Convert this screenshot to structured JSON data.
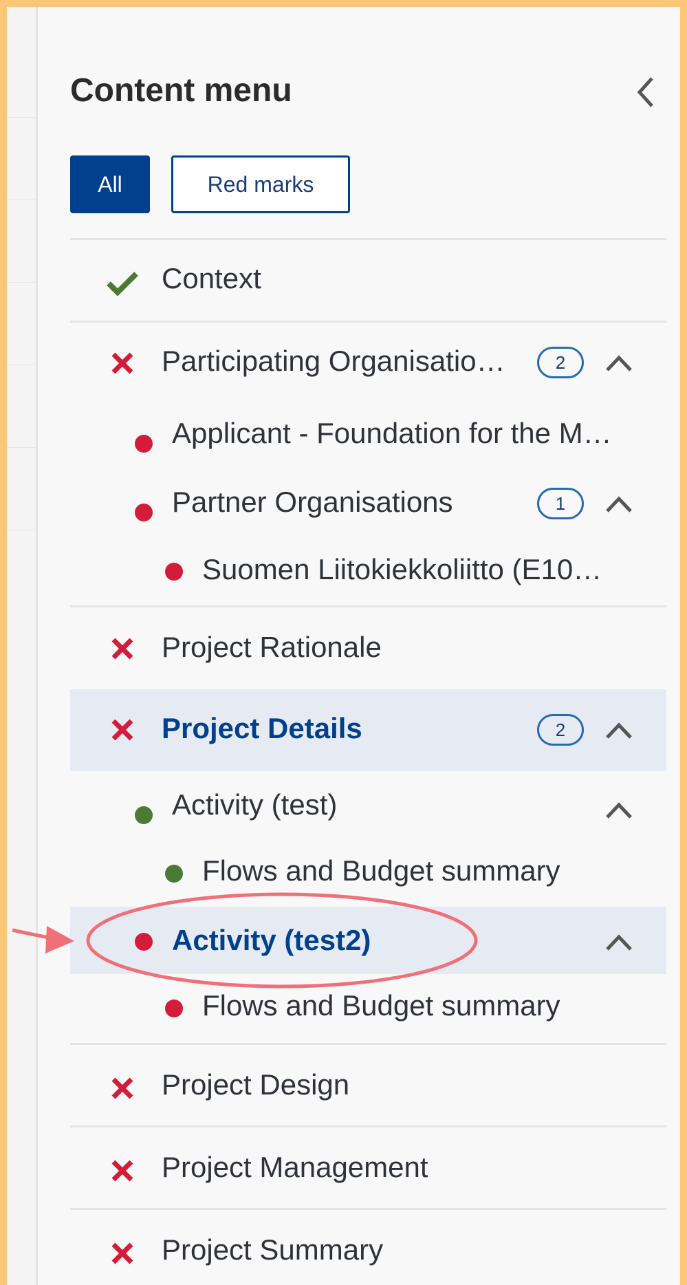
{
  "menu": {
    "title": "Content menu",
    "filters": {
      "all": "All",
      "red_marks": "Red marks"
    },
    "items": [
      {
        "label": "Context",
        "status": "check"
      },
      {
        "label": "Participating Organisatio…",
        "status": "x",
        "badge": "2",
        "expanded": true
      },
      {
        "label": "Applicant - Foundation for the M…",
        "status": "red-dot"
      },
      {
        "label": "Partner Organisations",
        "status": "red-dot",
        "badge": "1",
        "expanded": true
      },
      {
        "label": "Suomen Liitokiekkoliitto (E10…",
        "status": "red-dot"
      },
      {
        "label": "Project Rationale",
        "status": "x"
      },
      {
        "label": "Project Details",
        "status": "x",
        "badge": "2",
        "expanded": true,
        "active": true
      },
      {
        "label": "Activity (test)",
        "status": "green-dot",
        "expanded": true
      },
      {
        "label": "Flows and Budget summary",
        "status": "green-dot"
      },
      {
        "label": "Activity (test2)",
        "status": "red-dot",
        "expanded": true,
        "active": true,
        "highlighted": true
      },
      {
        "label": "Flows and Budget summary",
        "status": "red-dot"
      },
      {
        "label": "Project Design",
        "status": "x"
      },
      {
        "label": "Project Management",
        "status": "x"
      },
      {
        "label": "Project Summary",
        "status": "x"
      }
    ]
  },
  "colors": {
    "frame": "#FCC779",
    "primary": "#00408C",
    "error": "#D41B3A",
    "success": "#4A7A33",
    "annotation": "#F0707A"
  }
}
